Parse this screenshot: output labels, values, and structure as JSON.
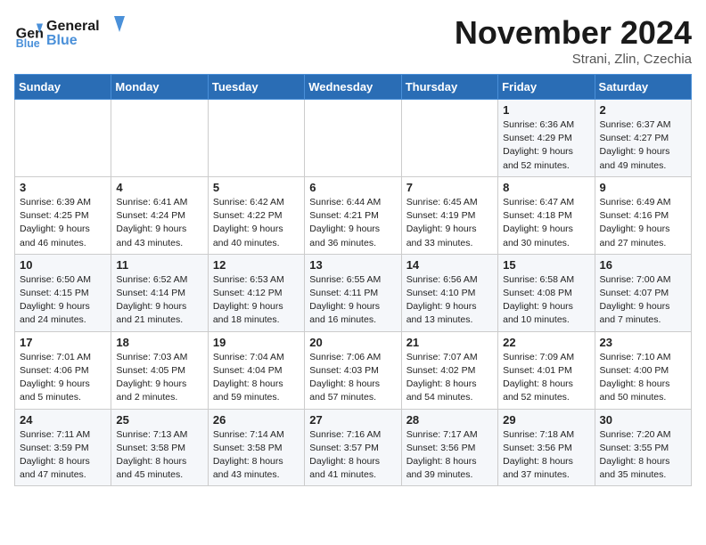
{
  "header": {
    "logo_line1": "General",
    "logo_line2": "Blue",
    "month_title": "November 2024",
    "subtitle": "Strani, Zlin, Czechia"
  },
  "days_of_week": [
    "Sunday",
    "Monday",
    "Tuesday",
    "Wednesday",
    "Thursday",
    "Friday",
    "Saturday"
  ],
  "weeks": [
    [
      {
        "day": "",
        "detail": ""
      },
      {
        "day": "",
        "detail": ""
      },
      {
        "day": "",
        "detail": ""
      },
      {
        "day": "",
        "detail": ""
      },
      {
        "day": "",
        "detail": ""
      },
      {
        "day": "1",
        "detail": "Sunrise: 6:36 AM\nSunset: 4:29 PM\nDaylight: 9 hours\nand 52 minutes."
      },
      {
        "day": "2",
        "detail": "Sunrise: 6:37 AM\nSunset: 4:27 PM\nDaylight: 9 hours\nand 49 minutes."
      }
    ],
    [
      {
        "day": "3",
        "detail": "Sunrise: 6:39 AM\nSunset: 4:25 PM\nDaylight: 9 hours\nand 46 minutes."
      },
      {
        "day": "4",
        "detail": "Sunrise: 6:41 AM\nSunset: 4:24 PM\nDaylight: 9 hours\nand 43 minutes."
      },
      {
        "day": "5",
        "detail": "Sunrise: 6:42 AM\nSunset: 4:22 PM\nDaylight: 9 hours\nand 40 minutes."
      },
      {
        "day": "6",
        "detail": "Sunrise: 6:44 AM\nSunset: 4:21 PM\nDaylight: 9 hours\nand 36 minutes."
      },
      {
        "day": "7",
        "detail": "Sunrise: 6:45 AM\nSunset: 4:19 PM\nDaylight: 9 hours\nand 33 minutes."
      },
      {
        "day": "8",
        "detail": "Sunrise: 6:47 AM\nSunset: 4:18 PM\nDaylight: 9 hours\nand 30 minutes."
      },
      {
        "day": "9",
        "detail": "Sunrise: 6:49 AM\nSunset: 4:16 PM\nDaylight: 9 hours\nand 27 minutes."
      }
    ],
    [
      {
        "day": "10",
        "detail": "Sunrise: 6:50 AM\nSunset: 4:15 PM\nDaylight: 9 hours\nand 24 minutes."
      },
      {
        "day": "11",
        "detail": "Sunrise: 6:52 AM\nSunset: 4:14 PM\nDaylight: 9 hours\nand 21 minutes."
      },
      {
        "day": "12",
        "detail": "Sunrise: 6:53 AM\nSunset: 4:12 PM\nDaylight: 9 hours\nand 18 minutes."
      },
      {
        "day": "13",
        "detail": "Sunrise: 6:55 AM\nSunset: 4:11 PM\nDaylight: 9 hours\nand 16 minutes."
      },
      {
        "day": "14",
        "detail": "Sunrise: 6:56 AM\nSunset: 4:10 PM\nDaylight: 9 hours\nand 13 minutes."
      },
      {
        "day": "15",
        "detail": "Sunrise: 6:58 AM\nSunset: 4:08 PM\nDaylight: 9 hours\nand 10 minutes."
      },
      {
        "day": "16",
        "detail": "Sunrise: 7:00 AM\nSunset: 4:07 PM\nDaylight: 9 hours\nand 7 minutes."
      }
    ],
    [
      {
        "day": "17",
        "detail": "Sunrise: 7:01 AM\nSunset: 4:06 PM\nDaylight: 9 hours\nand 5 minutes."
      },
      {
        "day": "18",
        "detail": "Sunrise: 7:03 AM\nSunset: 4:05 PM\nDaylight: 9 hours\nand 2 minutes."
      },
      {
        "day": "19",
        "detail": "Sunrise: 7:04 AM\nSunset: 4:04 PM\nDaylight: 8 hours\nand 59 minutes."
      },
      {
        "day": "20",
        "detail": "Sunrise: 7:06 AM\nSunset: 4:03 PM\nDaylight: 8 hours\nand 57 minutes."
      },
      {
        "day": "21",
        "detail": "Sunrise: 7:07 AM\nSunset: 4:02 PM\nDaylight: 8 hours\nand 54 minutes."
      },
      {
        "day": "22",
        "detail": "Sunrise: 7:09 AM\nSunset: 4:01 PM\nDaylight: 8 hours\nand 52 minutes."
      },
      {
        "day": "23",
        "detail": "Sunrise: 7:10 AM\nSunset: 4:00 PM\nDaylight: 8 hours\nand 50 minutes."
      }
    ],
    [
      {
        "day": "24",
        "detail": "Sunrise: 7:11 AM\nSunset: 3:59 PM\nDaylight: 8 hours\nand 47 minutes."
      },
      {
        "day": "25",
        "detail": "Sunrise: 7:13 AM\nSunset: 3:58 PM\nDaylight: 8 hours\nand 45 minutes."
      },
      {
        "day": "26",
        "detail": "Sunrise: 7:14 AM\nSunset: 3:58 PM\nDaylight: 8 hours\nand 43 minutes."
      },
      {
        "day": "27",
        "detail": "Sunrise: 7:16 AM\nSunset: 3:57 PM\nDaylight: 8 hours\nand 41 minutes."
      },
      {
        "day": "28",
        "detail": "Sunrise: 7:17 AM\nSunset: 3:56 PM\nDaylight: 8 hours\nand 39 minutes."
      },
      {
        "day": "29",
        "detail": "Sunrise: 7:18 AM\nSunset: 3:56 PM\nDaylight: 8 hours\nand 37 minutes."
      },
      {
        "day": "30",
        "detail": "Sunrise: 7:20 AM\nSunset: 3:55 PM\nDaylight: 8 hours\nand 35 minutes."
      }
    ]
  ]
}
